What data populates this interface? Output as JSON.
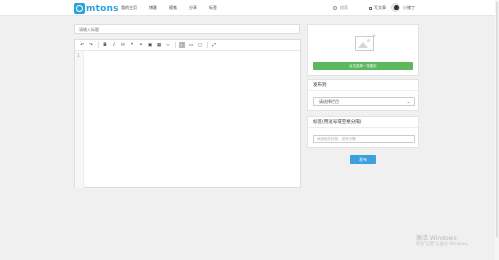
{
  "nav": {
    "logo_text": "mtons",
    "menu": [
      "我的主页",
      "博客",
      "随笔",
      "分享",
      "标签"
    ],
    "search_label": "搜索",
    "write_label": "写文章",
    "user_name": "小猪丁"
  },
  "editor": {
    "title_placeholder": "请输入标题",
    "line_number": "1",
    "toolbar_icons": [
      "undo-icon",
      "redo-icon",
      "bold-icon",
      "italic-icon",
      "heading-icon",
      "quote-icon",
      "link-icon",
      "image-icon",
      "table-icon",
      "code-icon",
      "preview-icon",
      "side-by-side-icon",
      "fullscreen-preview-icon",
      "expand-icon"
    ]
  },
  "thumbnail": {
    "upload_label": "点击选择一张图片"
  },
  "category": {
    "heading": "发布到",
    "selected": "请选择栏目"
  },
  "tags": {
    "heading": "标签(用逗号或空格分隔)",
    "placeholder": "添加相关标签，逗号分隔"
  },
  "actions": {
    "publish_label": "发布"
  },
  "watermark": {
    "line1": "激活 Windows",
    "line2": "转到\"设置\"以激活 Windows。"
  },
  "colors": {
    "brand": "#29a5dc",
    "upload_button": "#5cb85c",
    "publish_button": "#3aa0de"
  }
}
